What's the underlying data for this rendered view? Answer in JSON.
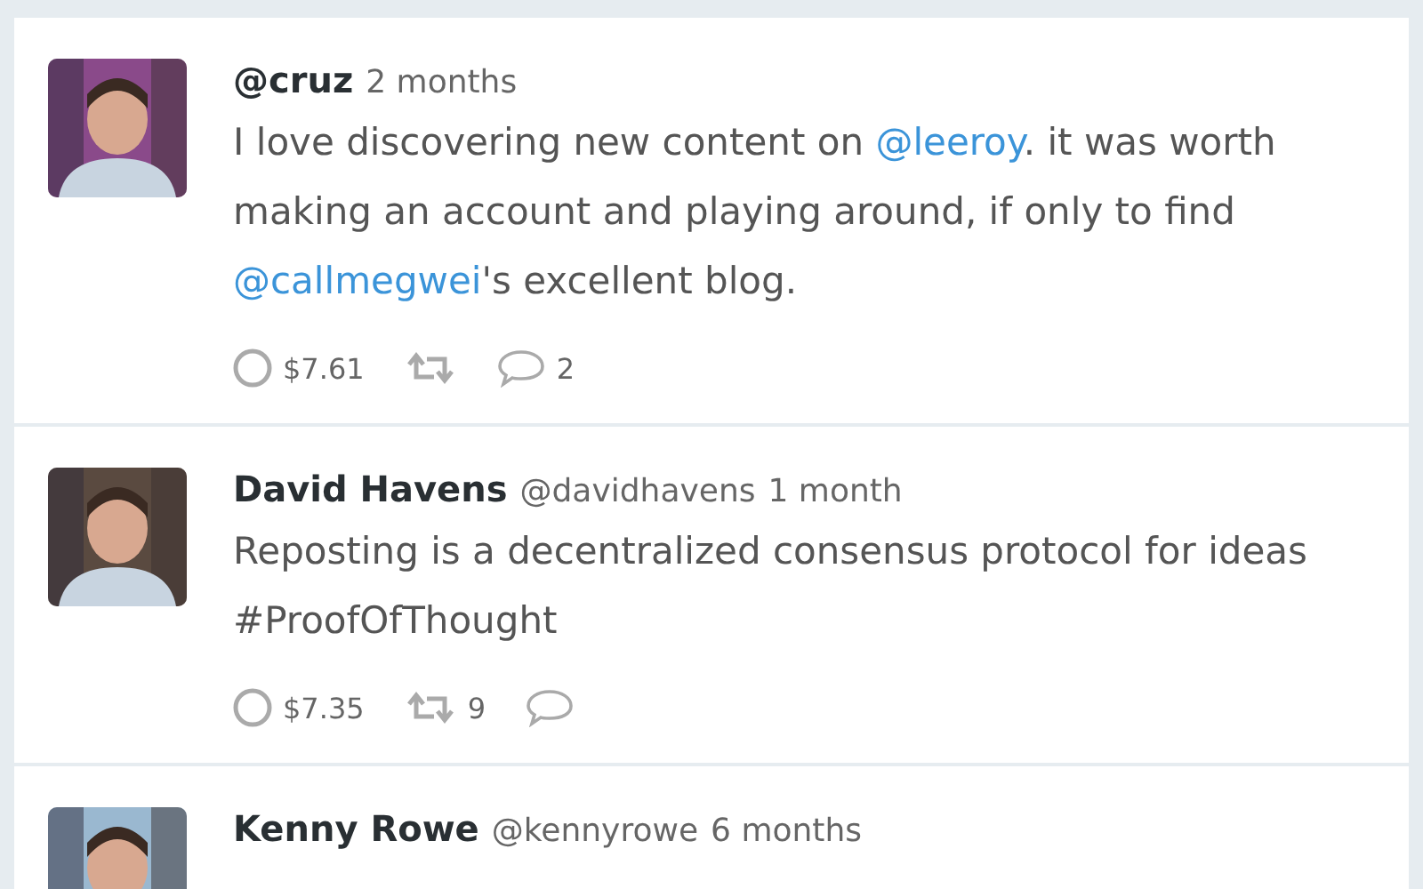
{
  "posts": [
    {
      "handle": "@cruz",
      "time": "2 months",
      "body": [
        {
          "kind": "text",
          "text": "I love discovering new content on "
        },
        {
          "kind": "mention",
          "text": "@leeroy"
        },
        {
          "kind": "text",
          "text": ". it was worth making an account and playing around, if only to find "
        },
        {
          "kind": "mention",
          "text": "@callmegwei"
        },
        {
          "kind": "text",
          "text": "'s excellent blog."
        }
      ],
      "amount": "$7.61",
      "replies": "2"
    },
    {
      "name": "David Havens",
      "handle": "@davidhavens",
      "time": "1 month",
      "body": [
        {
          "kind": "text",
          "text": "Reposting is a decentralized consensus protocol for ideas #ProofOfThought"
        }
      ],
      "amount": "$7.35",
      "reposts": "9"
    },
    {
      "name": "Kenny Rowe",
      "handle": "@kennyrowe",
      "time": "6 months"
    }
  ]
}
